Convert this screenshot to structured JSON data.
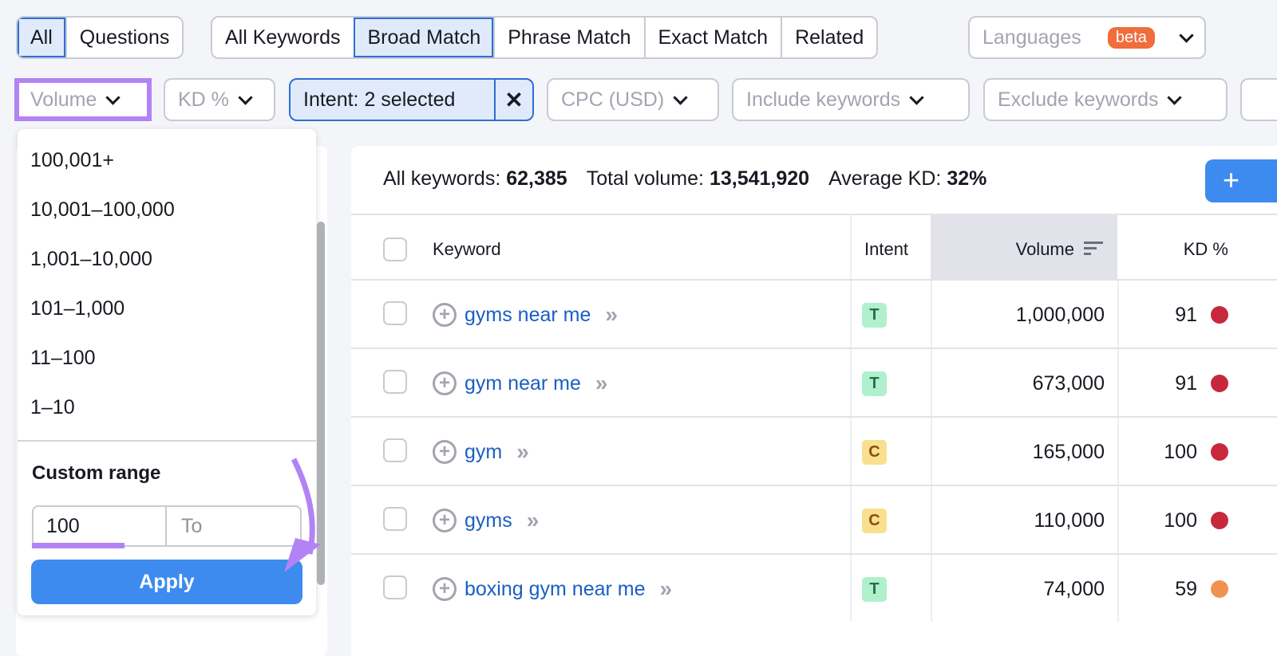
{
  "scope_tabs": [
    {
      "label": "All",
      "selected": true
    },
    {
      "label": "Questions",
      "selected": false
    }
  ],
  "match_tabs": [
    {
      "label": "All Keywords",
      "selected": false
    },
    {
      "label": "Broad Match",
      "selected": true
    },
    {
      "label": "Phrase Match",
      "selected": false
    },
    {
      "label": "Exact Match",
      "selected": false
    },
    {
      "label": "Related",
      "selected": false
    }
  ],
  "languages": {
    "label": "Languages",
    "badge": "beta"
  },
  "filters": {
    "volume": "Volume",
    "kd": "KD %",
    "intent": "Intent: 2 selected",
    "cpc": "CPC (USD)",
    "include": "Include keywords",
    "exclude": "Exclude keywords"
  },
  "volume_dropdown": {
    "options": [
      "100,001+",
      "10,001–100,000",
      "1,001–10,000",
      "101–1,000",
      "11–100",
      "1–10"
    ],
    "custom_range_title": "Custom range",
    "from_value": "100",
    "to_placeholder": "To",
    "apply_label": "Apply"
  },
  "summary": {
    "all_keywords_label": "All keywords:",
    "all_keywords": "62,385",
    "total_volume_label": "Total volume:",
    "total_volume": "13,541,920",
    "avg_kd_label": "Average KD:",
    "avg_kd": "32%"
  },
  "table": {
    "headers": {
      "keyword": "Keyword",
      "intent": "Intent",
      "volume": "Volume",
      "kd": "KD %"
    },
    "rows": [
      {
        "keyword": "gyms near me",
        "intent": "T",
        "volume": "1,000,000",
        "kd": "91",
        "kd_color": "#c8283c"
      },
      {
        "keyword": "gym near me",
        "intent": "T",
        "volume": "673,000",
        "kd": "91",
        "kd_color": "#c8283c"
      },
      {
        "keyword": "gym",
        "intent": "C",
        "volume": "165,000",
        "kd": "100",
        "kd_color": "#c8283c"
      },
      {
        "keyword": "gyms",
        "intent": "C",
        "volume": "110,000",
        "kd": "100",
        "kd_color": "#c8283c"
      },
      {
        "keyword": "boxing gym near me",
        "intent": "T",
        "volume": "74,000",
        "kd": "59",
        "kd_color": "#f0924f"
      }
    ]
  },
  "colors": {
    "accent": "#3d8bef",
    "highlight": "#b283f5",
    "intent_T_bg": "#b0f0cc",
    "intent_T_fg": "#22704a",
    "intent_C_bg": "#f8e08e",
    "intent_C_fg": "#8a4f10"
  }
}
